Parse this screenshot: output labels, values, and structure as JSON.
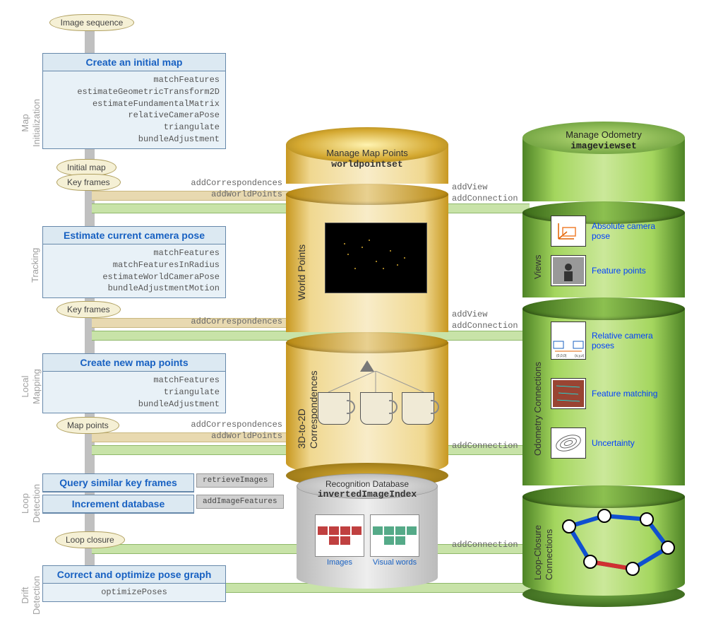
{
  "top_badge": "Image sequence",
  "phases": {
    "map_init": "Map\nInitialization",
    "tracking": "Tracking",
    "local_mapping": "Local\nMapping",
    "loop_detection": "Loop\nDetection",
    "drift_detection": "Drift\nDetection"
  },
  "steps": {
    "create_map": {
      "title": "Create an initial map",
      "funcs": [
        "matchFeatures",
        "estimateGeometricTransform2D",
        "estimateFundamentalMatrix",
        "relativeCameraPose",
        "triangulate",
        "bundleAdjustment"
      ]
    },
    "estimate_pose": {
      "title": "Estimate current camera pose",
      "funcs": [
        "matchFeatures",
        "matchFeaturesInRadius",
        "estimateWorldCameraPose",
        "bundleAdjustmentMotion"
      ]
    },
    "create_points": {
      "title": "Create new map points",
      "funcs": [
        "matchFeatures",
        "triangulate",
        "bundleAdjustment"
      ]
    },
    "query": {
      "title": "Query similar key frames"
    },
    "increment": {
      "title": "Increment database"
    },
    "correct": {
      "title": "Correct and optimize pose graph",
      "funcs": [
        "optimizePoses"
      ]
    }
  },
  "badges": {
    "initial_map": "Initial map",
    "key_frames": "Key frames",
    "key_frames2": "Key frames",
    "map_points": "Map points",
    "loop_closure": "Loop closure"
  },
  "connectors": {
    "addCorr": "addCorrespondences",
    "addWorld": "addWorldPoints",
    "addView": "addView",
    "addConn": "addConnection",
    "retrieve": "retrieveImages",
    "addImgFeat": "addImageFeatures"
  },
  "gold": {
    "title": "Manage Map Points",
    "code": "worldpointset",
    "seg2": "World Points",
    "seg3": "3D-to-2D\nCorrespondences"
  },
  "gray": {
    "title": "Recognition Database",
    "code": "invertedImageIndex",
    "images": "Images",
    "words": "Visual words"
  },
  "green": {
    "title": "Manage Odometry",
    "code": "imageviewset",
    "views": "Views",
    "odom": "Odometry Connections",
    "loop": "Loop-Closure\nConnections",
    "items": {
      "abs_pose": "Absolute camera pose",
      "feat_pts": "Feature points",
      "rel_pose": "Relative camera poses",
      "feat_match": "Feature matching",
      "uncertainty": "Uncertainty"
    }
  }
}
